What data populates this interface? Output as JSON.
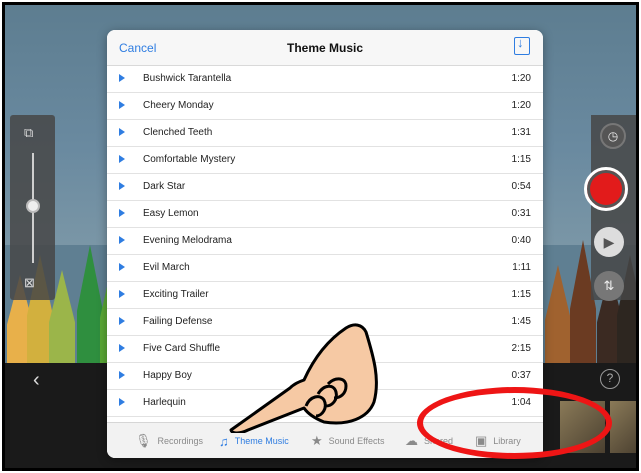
{
  "modal": {
    "cancel_label": "Cancel",
    "title": "Theme Music"
  },
  "tracks": [
    {
      "name": "Bushwick Tarantella",
      "duration": "1:20"
    },
    {
      "name": "Cheery Monday",
      "duration": "1:20"
    },
    {
      "name": "Clenched Teeth",
      "duration": "1:31"
    },
    {
      "name": "Comfortable Mystery",
      "duration": "1:15"
    },
    {
      "name": "Dark Star",
      "duration": "0:54"
    },
    {
      "name": "Easy Lemon",
      "duration": "0:31"
    },
    {
      "name": "Evening Melodrama",
      "duration": "0:40"
    },
    {
      "name": "Evil March",
      "duration": "1:11"
    },
    {
      "name": "Exciting Trailer",
      "duration": "1:15"
    },
    {
      "name": "Failing Defense",
      "duration": "1:45"
    },
    {
      "name": "Five Card Shuffle",
      "duration": "2:15"
    },
    {
      "name": "Happy Boy",
      "duration": "0:37"
    },
    {
      "name": "Harlequin",
      "duration": "1:04"
    }
  ],
  "tabs": {
    "recordings": "Recordings",
    "theme_music": "Theme Music",
    "sound_effects": "Sound Effects",
    "shared": "Shared",
    "library": "Library",
    "active": "theme_music"
  },
  "icons": {
    "record": "record-icon",
    "play": "play-icon",
    "timer": "timer-icon",
    "mixer": "mixer-icon",
    "help": "help-icon",
    "back": "chevron-left-icon",
    "download": "download-icon"
  },
  "colors": {
    "accent": "#2f7de1",
    "record": "#e21b1b",
    "annotation": "#ee1515"
  }
}
